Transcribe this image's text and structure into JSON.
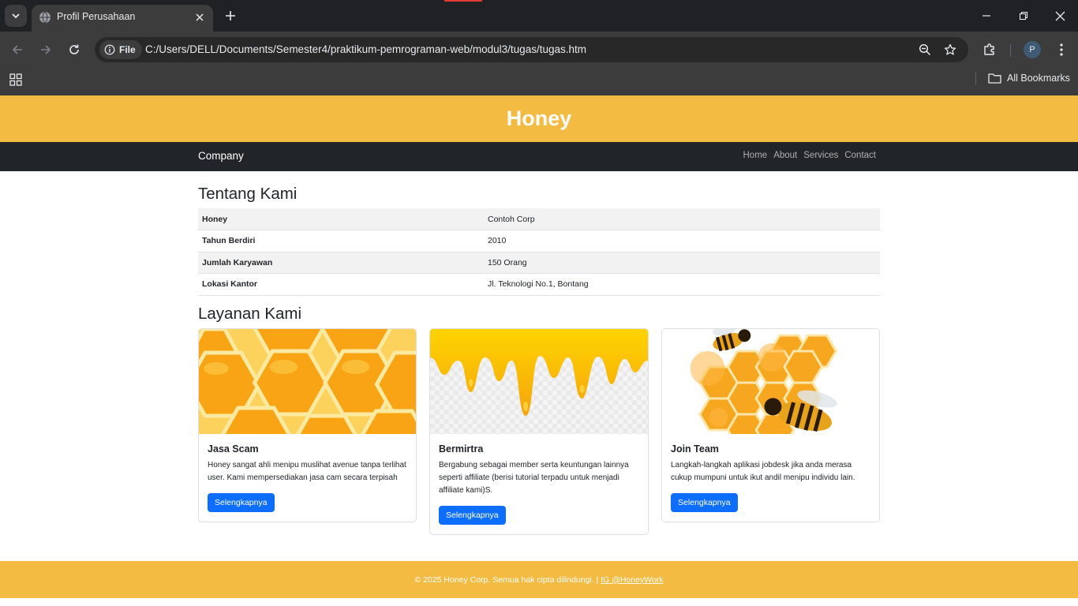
{
  "browser": {
    "tab_title": "Profil Perusahaan",
    "chip_label": "File",
    "url": "C:/Users/DELL/Documents/Semester4/praktikum-pemrograman-web/modul3/tugas/tugas.htm",
    "profile_initial": "P",
    "bookmarks_label": "All Bookmarks"
  },
  "hero": {
    "title": "Honey"
  },
  "navbar": {
    "brand": "Company",
    "links": [
      "Home",
      "About",
      "Services",
      "Contact"
    ]
  },
  "about": {
    "heading": "Tentang Kami",
    "rows": [
      {
        "key": "Honey",
        "value": "Contoh Corp"
      },
      {
        "key": "Tahun Berdiri",
        "value": "2010"
      },
      {
        "key": "Jumlah Karyawan",
        "value": "150 Orang"
      },
      {
        "key": "Lokasi Kantor",
        "value": "Jl. Teknologi No.1, Bontang"
      }
    ]
  },
  "services": {
    "heading": "Layanan Kami",
    "cards": [
      {
        "title": "Jasa Scam",
        "text": "Honey sangat ahli menipu muslihat avenue tanpa terlihat user. Kami mempersediakan jasa cam secara terpisah",
        "button": "Selengkapnya"
      },
      {
        "title": "Bermirtra",
        "text": "Bergabung sebagai member serta keuntungan lainnya seperti affiliate (berisi tutorial terpadu untuk menjadi affiliate kami)S.",
        "button": "Selengkapnya"
      },
      {
        "title": "Join Team",
        "text": "Langkah-langkah aplikasi jobdesk jika anda merasa cukup mumpuni untuk ikut andil menipu individu lain.",
        "button": "Selengkapnya"
      }
    ]
  },
  "footer": {
    "text": "© 2025 Honey Corp. Semua hak cipta dilindungi. |",
    "link": "IG @HoneyWork"
  },
  "colors": {
    "accent": "#f4bb43",
    "navbar": "#212529",
    "button": "#0d6efd"
  }
}
